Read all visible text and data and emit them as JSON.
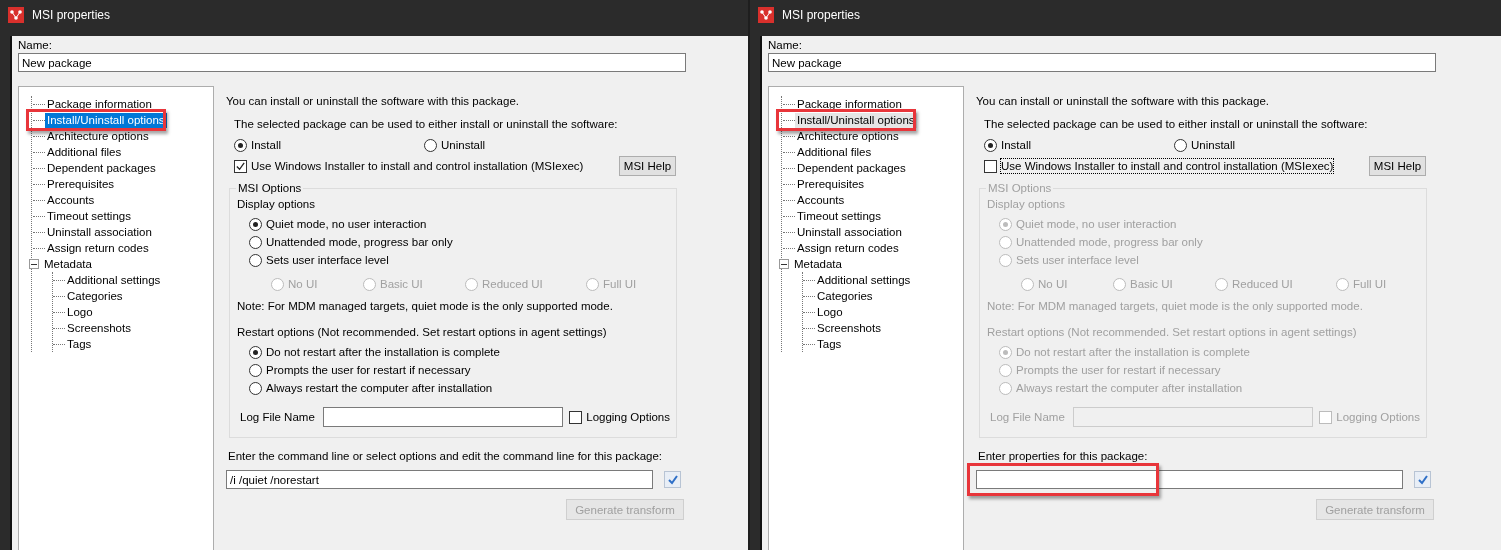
{
  "windows": [
    {
      "title": "MSI properties",
      "tree_focused": true,
      "name_label": "Name:",
      "name_value": "New package",
      "tree": [
        {
          "label": "Package information",
          "selected": false
        },
        {
          "label": "Install/Uninstall options",
          "selected": true,
          "highlighted": true
        },
        {
          "label": "Architecture options",
          "selected": false
        },
        {
          "label": "Additional files",
          "selected": false
        },
        {
          "label": "Dependent packages",
          "selected": false
        },
        {
          "label": "Prerequisites",
          "selected": false
        },
        {
          "label": "Accounts",
          "selected": false
        },
        {
          "label": "Timeout settings",
          "selected": false
        },
        {
          "label": "Uninstall association",
          "selected": false
        },
        {
          "label": "Assign return codes",
          "selected": false
        },
        {
          "label": "Metadata",
          "selected": false,
          "expanded": true,
          "children": [
            {
              "label": "Additional settings",
              "selected": false
            },
            {
              "label": "Categories",
              "selected": false
            },
            {
              "label": "Logo",
              "selected": false
            },
            {
              "label": "Screenshots",
              "selected": false
            },
            {
              "label": "Tags",
              "selected": false
            }
          ]
        }
      ],
      "intro": "You can install or uninstall the software with this package.",
      "mode_prompt": "The selected package can be used to either install or uninstall the software:",
      "modes": [
        {
          "label": "Install",
          "selected": true
        },
        {
          "label": "Uninstall",
          "selected": false
        }
      ],
      "msiexec": {
        "label": "Use Windows Installer to install and control installation (MSIexec)",
        "checked": true
      },
      "help_button": "MSI Help",
      "msi_options": {
        "title": "MSI Options",
        "disabled": false,
        "display_label": "Display options",
        "display_options": [
          {
            "label": "Quiet mode, no user interaction",
            "selected": true
          },
          {
            "label": "Unattended mode, progress bar only",
            "selected": false
          },
          {
            "label": "Sets user interface level",
            "selected": false
          }
        ],
        "ui_levels": [
          {
            "label": "No UI",
            "selected": false
          },
          {
            "label": "Basic UI",
            "selected": false
          },
          {
            "label": "Reduced UI",
            "selected": false
          },
          {
            "label": "Full UI",
            "selected": false
          }
        ],
        "note": "Note: For MDM managed targets, quiet mode is the only supported mode.",
        "restart_label": "Restart options (Not recommended. Set restart options in agent settings)",
        "restart_options": [
          {
            "label": "Do not restart after the installation is complete",
            "selected": true
          },
          {
            "label": "Prompts the user for restart if necessary",
            "selected": false
          },
          {
            "label": "Always restart the computer after installation",
            "selected": false
          }
        ],
        "log_label": "Log File Name",
        "logging": {
          "label": "Logging Options",
          "checked": false
        }
      },
      "command": {
        "label": "Enter the command line or select options and edit the command line for this package:",
        "value": "/i /quiet /norestart"
      },
      "transform_button": {
        "label": "Generate transform",
        "disabled": true
      }
    },
    {
      "title": "MSI properties",
      "tree_focused": false,
      "name_label": "Name:",
      "name_value": "New package",
      "tree": [
        {
          "label": "Package information",
          "selected": false
        },
        {
          "label": "Install/Uninstall options",
          "selected": true,
          "highlighted": true
        },
        {
          "label": "Architecture options",
          "selected": false
        },
        {
          "label": "Additional files",
          "selected": false
        },
        {
          "label": "Dependent packages",
          "selected": false
        },
        {
          "label": "Prerequisites",
          "selected": false
        },
        {
          "label": "Accounts",
          "selected": false
        },
        {
          "label": "Timeout settings",
          "selected": false
        },
        {
          "label": "Uninstall association",
          "selected": false
        },
        {
          "label": "Assign return codes",
          "selected": false
        },
        {
          "label": "Metadata",
          "selected": false,
          "expanded": true,
          "children": [
            {
              "label": "Additional settings",
              "selected": false
            },
            {
              "label": "Categories",
              "selected": false
            },
            {
              "label": "Logo",
              "selected": false
            },
            {
              "label": "Screenshots",
              "selected": false
            },
            {
              "label": "Tags",
              "selected": false
            }
          ]
        }
      ],
      "intro": "You can install or uninstall the software with this package.",
      "mode_prompt": "The selected package can be used to either install or uninstall the software:",
      "modes": [
        {
          "label": "Install",
          "selected": true
        },
        {
          "label": "Uninstall",
          "selected": false
        }
      ],
      "msiexec": {
        "label": "Use Windows Installer to install and control installation (MSIexec)",
        "checked": false,
        "focused": true
      },
      "help_button": "MSI Help",
      "msi_options": {
        "title": "MSI Options",
        "disabled": true,
        "display_label": "Display options",
        "display_options": [
          {
            "label": "Quiet mode, no user interaction",
            "selected": true
          },
          {
            "label": "Unattended mode, progress bar only",
            "selected": false
          },
          {
            "label": "Sets user interface level",
            "selected": false
          }
        ],
        "ui_levels": [
          {
            "label": "No UI",
            "selected": false
          },
          {
            "label": "Basic UI",
            "selected": false
          },
          {
            "label": "Reduced UI",
            "selected": false
          },
          {
            "label": "Full UI",
            "selected": false
          }
        ],
        "note": "Note: For MDM managed targets, quiet mode is the only supported mode.",
        "restart_label": "Restart options (Not recommended. Set restart options in agent settings)",
        "restart_options": [
          {
            "label": "Do not restart after the installation is complete",
            "selected": true
          },
          {
            "label": "Prompts the user for restart if necessary",
            "selected": false
          },
          {
            "label": "Always restart the computer after installation",
            "selected": false
          }
        ],
        "log_label": "Log File Name",
        "logging": {
          "label": "Logging Options",
          "checked": false
        }
      },
      "command": {
        "label": "Enter properties for this package:",
        "highlighted": true
      },
      "transform_button": {
        "label": "Generate transform",
        "disabled": true
      }
    }
  ]
}
